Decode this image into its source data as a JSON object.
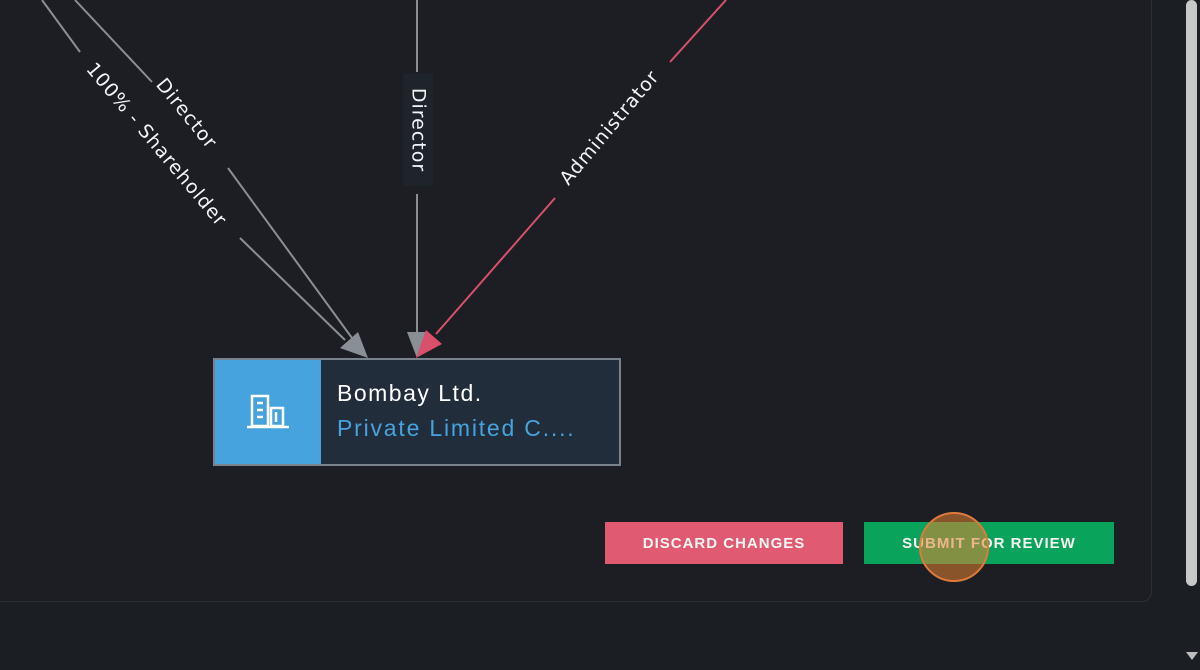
{
  "graph": {
    "edges": [
      {
        "label": "Director",
        "color": "#8a8f96"
      },
      {
        "label": "100% - Shareholder",
        "color": "#8a8f96"
      },
      {
        "label": "Director",
        "color": "#8a8f96"
      },
      {
        "label": "Administrator",
        "color": "#d9506a"
      }
    ],
    "node": {
      "name": "Bombay Ltd.",
      "type": "Private Limited C....",
      "icon": "building-icon",
      "accent": "#46a3dd"
    }
  },
  "actions": {
    "discard_label": "DISCARD CHANGES",
    "submit_label": "SUBMIT FOR REVIEW"
  },
  "colors": {
    "background": "#1b1e23",
    "discard": "#e05a72",
    "submit": "#0aa35c",
    "gray_edge": "#8a8f96",
    "red_edge": "#d9506a"
  }
}
